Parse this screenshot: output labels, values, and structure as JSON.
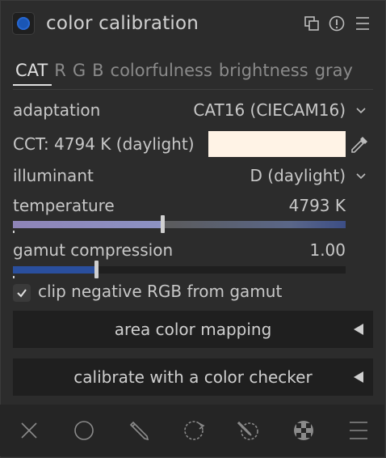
{
  "header": {
    "title": "color calibration"
  },
  "tabs": [
    {
      "label": "CAT",
      "active": true
    },
    {
      "label": "R",
      "active": false
    },
    {
      "label": "G",
      "active": false
    },
    {
      "label": "B",
      "active": false
    },
    {
      "label": "colorfulness",
      "active": false
    },
    {
      "label": "brightness",
      "active": false
    },
    {
      "label": "gray",
      "active": false
    }
  ],
  "adaptation": {
    "label": "adaptation",
    "value": "CAT16 (CIECAM16)"
  },
  "cct": {
    "label": "CCT: 4794 K (daylight)",
    "swatch_color": "#fff3e6"
  },
  "illuminant": {
    "label": "illuminant",
    "value": "D (daylight)"
  },
  "temperature": {
    "label": "temperature",
    "value": "4793 K",
    "position": 0.45
  },
  "gamut": {
    "label": "gamut compression",
    "value": "1.00",
    "position": 0.25,
    "fill_color": "#2a4f9e"
  },
  "clip": {
    "label": "clip negative RGB from gamut",
    "checked": true
  },
  "sections": {
    "area_mapping": "area color mapping",
    "color_checker": "calibrate with a color checker"
  },
  "colors": {
    "accent": "#1a56b5",
    "background": "#2c2c2c"
  },
  "footer_icons": [
    "close-icon",
    "circle-mask-icon",
    "pencil-mask-icon",
    "parametric-mask-icon",
    "drawn-parametric-mask-icon",
    "raster-mask-icon",
    "menu-icon"
  ]
}
